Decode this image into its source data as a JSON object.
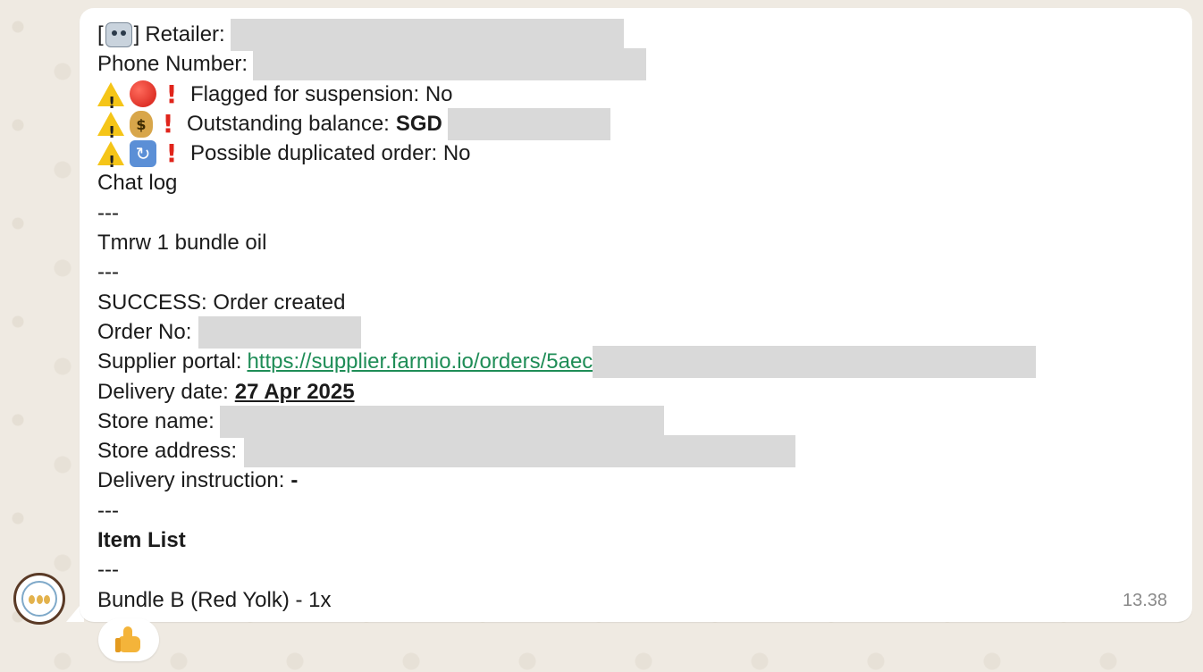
{
  "message": {
    "retailer_prefix_open": "[",
    "retailer_prefix_close": "]",
    "retailer_label": "Retailer:",
    "phone_label": "Phone Number:",
    "flagged_text": "Flagged for suspension: No",
    "outstanding_label": "Outstanding balance:",
    "outstanding_currency": "SGD",
    "duplicate_text": "Possible duplicated order: No",
    "chat_log_label": "Chat log",
    "separator": "---",
    "chat_line": "Tmrw 1 bundle oil",
    "success_text": "SUCCESS: Order created",
    "order_no_label": "Order No:",
    "supplier_portal_label": "Supplier portal:",
    "supplier_portal_link": "https://supplier.farmio.io/orders/5aec",
    "delivery_date_label": "Delivery date:",
    "delivery_date_value": "27 Apr 2025",
    "store_name_label": "Store name:",
    "store_address_label": "Store address:",
    "delivery_instruction_label": "Delivery instruction:",
    "delivery_instruction_value": "-",
    "item_list_label": "Item List",
    "item_line": "Bundle B (Red Yolk) - 1x"
  },
  "timestamp": "13.38",
  "icons": {
    "robot": "robot-icon",
    "warning": "warning-icon",
    "red_circle": "red-circle-icon",
    "exclamation": "exclamation-icon",
    "money_bag": "money-bag-icon",
    "repeat": "repeat-icon",
    "thumbs_up": "thumbs-up-icon"
  },
  "colors": {
    "bubble": "#ffffff",
    "background": "#efeae2",
    "link": "#1f8d57",
    "redaction": "#d9d9d9",
    "timestamp": "#8a8a8a"
  }
}
